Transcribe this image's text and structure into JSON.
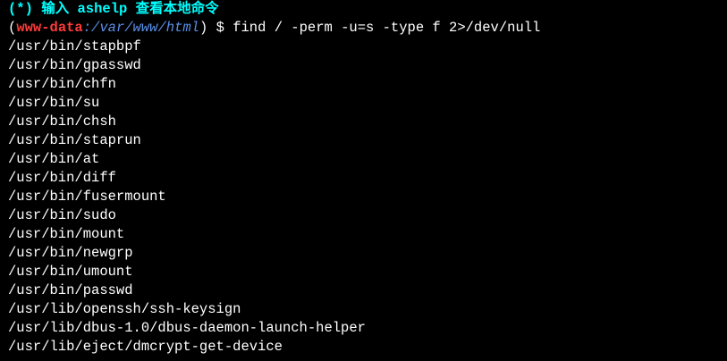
{
  "banner": "(*) 输入 ashelp 查看本地命令",
  "prompt": {
    "open_paren": "(",
    "user": "www-data",
    "separator": ":",
    "cwd": "/var/www/html",
    "close_paren": ")",
    "symbol": " $ ",
    "command": "find / -perm -u=s -type f 2>/dev/null"
  },
  "output": [
    "/usr/bin/stapbpf",
    "/usr/bin/gpasswd",
    "/usr/bin/chfn",
    "/usr/bin/su",
    "/usr/bin/chsh",
    "/usr/bin/staprun",
    "/usr/bin/at",
    "/usr/bin/diff",
    "/usr/bin/fusermount",
    "/usr/bin/sudo",
    "/usr/bin/mount",
    "/usr/bin/newgrp",
    "/usr/bin/umount",
    "/usr/bin/passwd",
    "/usr/lib/openssh/ssh-keysign",
    "/usr/lib/dbus-1.0/dbus-daemon-launch-helper",
    "/usr/lib/eject/dmcrypt-get-device"
  ],
  "colors": {
    "background": "#000000",
    "banner": "#00ffff",
    "user": "#ff3b3b",
    "path": "#5a8fe6",
    "text": "#ffffff"
  }
}
